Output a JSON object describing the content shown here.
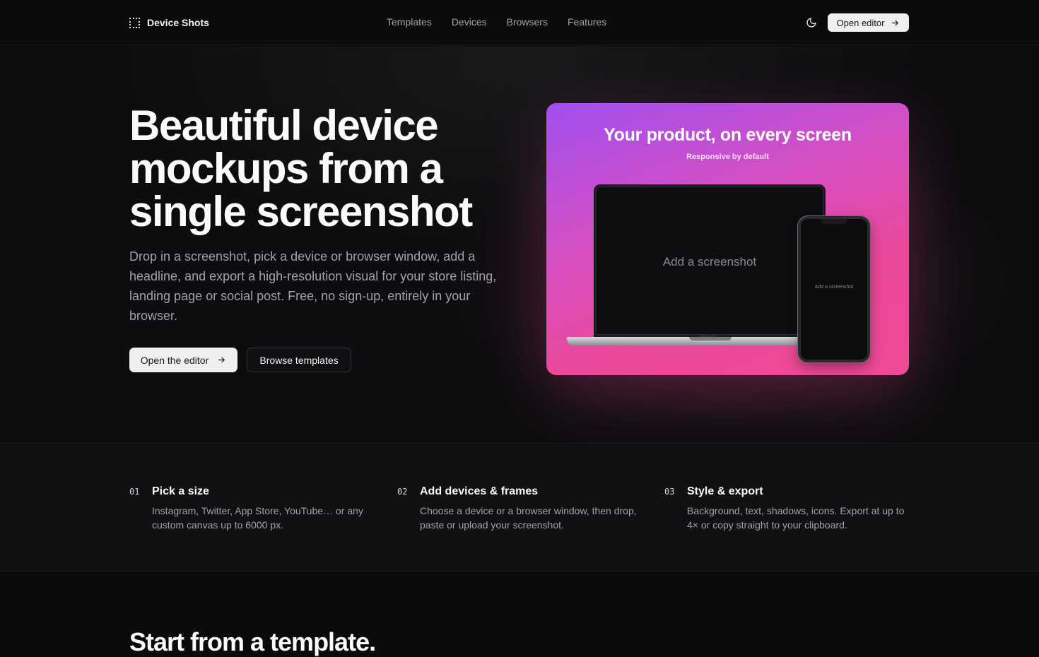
{
  "header": {
    "brand": "Device Shots",
    "nav": [
      "Templates",
      "Devices",
      "Browsers",
      "Features"
    ],
    "open_editor_label": "Open editor"
  },
  "hero": {
    "title": "Beautiful device mockups from a single screenshot",
    "description": "Drop in a screenshot, pick a device or browser window, add a headline, and export a high-resolution visual for your store listing, landing page or social post. Free, no sign-up, entirely in your browser.",
    "primary_button": "Open the editor",
    "secondary_button": "Browse templates",
    "mockup": {
      "title": "Your product, on every screen",
      "subtitle": "Responsive by default",
      "laptop_placeholder": "Add a screenshot",
      "laptop_label": "MacBook Pro",
      "phone_placeholder": "Add a screenshot",
      "gradient_colors": [
        "#a14ff0",
        "#ec4899"
      ]
    }
  },
  "features": [
    {
      "num": "01",
      "title": "Pick a size",
      "desc": "Instagram, Twitter, App Store, YouTube… or any custom canvas up to 6000 px."
    },
    {
      "num": "02",
      "title": "Add devices & frames",
      "desc": "Choose a device or a browser window, then drop, paste or upload your screenshot."
    },
    {
      "num": "03",
      "title": "Style & export",
      "desc": "Background, text, shadows, icons. Export at up to 4× or copy straight to your clipboard."
    }
  ],
  "templates": {
    "title": "Start from a template."
  },
  "icons": {
    "brand": "dotted-square-icon",
    "theme": "moon-icon",
    "arrow": "arrow-right-icon"
  }
}
